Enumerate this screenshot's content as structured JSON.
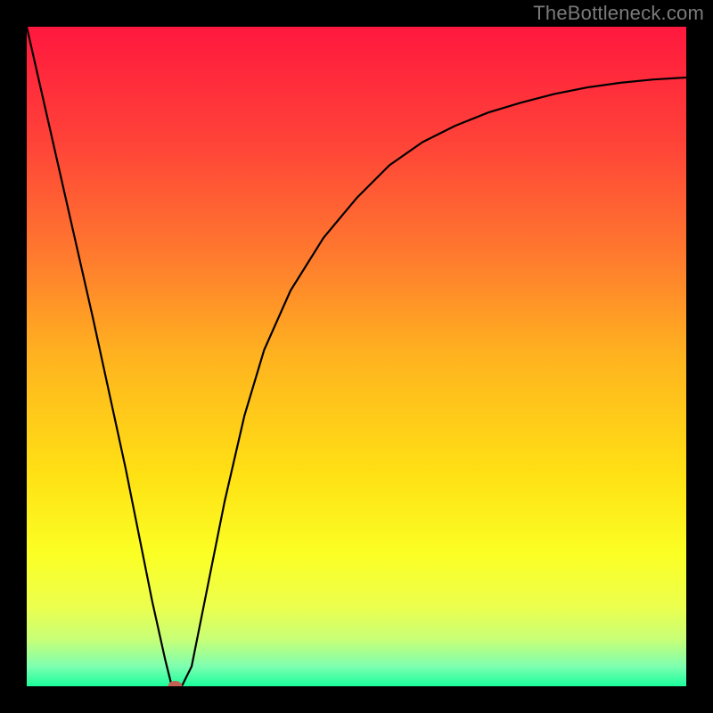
{
  "watermark": "TheBottleneck.com",
  "chart_data": {
    "type": "line",
    "title": "",
    "xlabel": "",
    "ylabel": "",
    "xlim": [
      0,
      100
    ],
    "ylim": [
      0,
      100
    ],
    "grid": false,
    "legend": "none",
    "series": [
      {
        "name": "curve",
        "x": [
          0,
          5,
          10,
          15,
          19,
          21,
          22,
          23.5,
          25,
          27,
          30,
          33,
          36,
          40,
          45,
          50,
          55,
          60,
          65,
          70,
          75,
          80,
          85,
          90,
          95,
          100
        ],
        "values": [
          100,
          78,
          56,
          33,
          13,
          4,
          0,
          0,
          3,
          13,
          28,
          41,
          51,
          60,
          68,
          74,
          79,
          82.5,
          85,
          87,
          88.5,
          89.8,
          90.8,
          91.5,
          92,
          92.3
        ]
      }
    ],
    "annotations": [
      {
        "name": "min-point-marker",
        "x": 22.5,
        "y": 0
      }
    ],
    "background_gradient": {
      "stops": [
        {
          "offset": 0.0,
          "color": "#ff183e"
        },
        {
          "offset": 0.18,
          "color": "#ff4438"
        },
        {
          "offset": 0.35,
          "color": "#ff7b2e"
        },
        {
          "offset": 0.5,
          "color": "#ffb31f"
        },
        {
          "offset": 0.68,
          "color": "#ffe114"
        },
        {
          "offset": 0.8,
          "color": "#fbff24"
        },
        {
          "offset": 0.88,
          "color": "#ecff4e"
        },
        {
          "offset": 0.93,
          "color": "#c6ff78"
        },
        {
          "offset": 0.97,
          "color": "#7dffb0"
        },
        {
          "offset": 1.0,
          "color": "#1bfd9c"
        }
      ]
    },
    "marker_color": "#c36154"
  }
}
